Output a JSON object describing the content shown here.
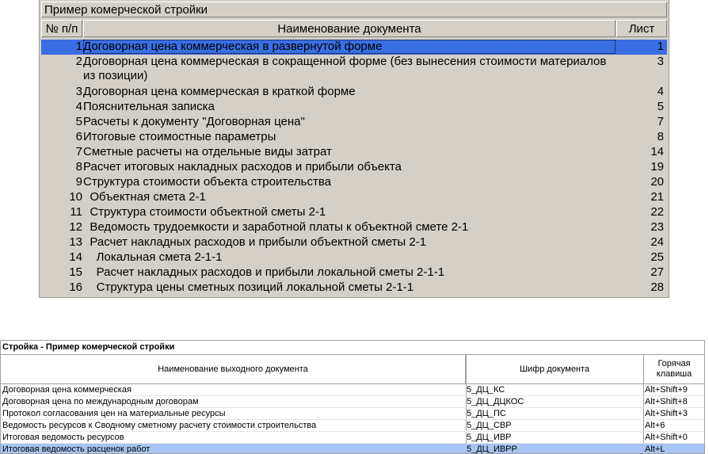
{
  "panel1": {
    "title": "Пример комерческой стройки",
    "headers": {
      "num": "№ п/п",
      "name": "Наименование документа",
      "sheet": "Лист"
    },
    "rows": [
      {
        "num": "1",
        "name": "Договорная цена коммерческая в развернутой форме",
        "sheet": "1",
        "selected": true
      },
      {
        "num": "2",
        "name": "Договорная цена коммерческая в сокращенной форме (без вынесения стоимости материалов из позиции)",
        "sheet": "3",
        "tall": true
      },
      {
        "num": "3",
        "name": "Договорная цена коммерческая в краткой форме",
        "sheet": "4"
      },
      {
        "num": "4",
        "name": "Пояснительная записка",
        "sheet": "5"
      },
      {
        "num": "5",
        "name": "Расчеты к документу \"Договорная цена\"",
        "sheet": "7"
      },
      {
        "num": "6",
        "name": "Итоговые стоимостные параметры",
        "sheet": "8"
      },
      {
        "num": "7",
        "name": "Сметные расчеты на отдельные виды затрат",
        "sheet": "14"
      },
      {
        "num": "8",
        "name": "Расчет итоговых накладных расходов и прибыли объекта",
        "sheet": "19"
      },
      {
        "num": "9",
        "name": "Структура стоимости объекта строительства",
        "sheet": "20"
      },
      {
        "num": "10",
        "name": "  Объектная смета 2-1",
        "sheet": "21"
      },
      {
        "num": "11",
        "name": "  Структура стоимости объектной сметы 2-1",
        "sheet": "22"
      },
      {
        "num": "12",
        "name": "  Ведомость трудоемкости и заработной платы к объектной смете 2-1",
        "sheet": "23"
      },
      {
        "num": "13",
        "name": "  Расчет накладных расходов и прибыли объектной сметы 2-1",
        "sheet": "24"
      },
      {
        "num": "14",
        "name": "    Локальная смета 2-1-1",
        "sheet": "25"
      },
      {
        "num": "15",
        "name": "    Расчет накладных расходов и прибыли локальной сметы 2-1-1",
        "sheet": "27"
      },
      {
        "num": "16",
        "name": "    Структура цены сметных позиций локальной сметы 2-1-1",
        "sheet": "28"
      }
    ]
  },
  "panel2": {
    "title": "Стройка - Пример комерческой стройки",
    "headers": {
      "name": "Наименование выходного документа",
      "code": "Шифр документа",
      "hotkey": "Горячая клавиша"
    },
    "rows": [
      {
        "name": "Договорная цена коммерческая",
        "code": "5_ДЦ_КС",
        "hotkey": "Alt+Shift+9"
      },
      {
        "name": "Договорная цена по международным договорам",
        "code": "5_ДЦ_ДЦКОС",
        "hotkey": "Alt+Shift+8"
      },
      {
        "name": "Протокол согласования цен на материальные ресурсы",
        "code": "5_ДЦ_ПС",
        "hotkey": "Alt+Shift+3"
      },
      {
        "name": "Ведомость ресурсов к Сводному сметному расчету стоимости строительства",
        "code": "5_ДЦ_СВР",
        "hotkey": "Alt+6"
      },
      {
        "name": "Итоговая ведомость ресурсов",
        "code": "5_ДЦ_ИВР",
        "hotkey": "Alt+Shift+0"
      },
      {
        "name": "Итоговая ведомость расценок работ",
        "code": "5_ДЦ_ИВРР",
        "hotkey": "Alt+L",
        "selected": true
      }
    ]
  },
  "colors": {
    "selection_top": "#3a6ee3",
    "selection_bottom": "#a8c4f2",
    "panel_bg": "#d4d0c8"
  }
}
